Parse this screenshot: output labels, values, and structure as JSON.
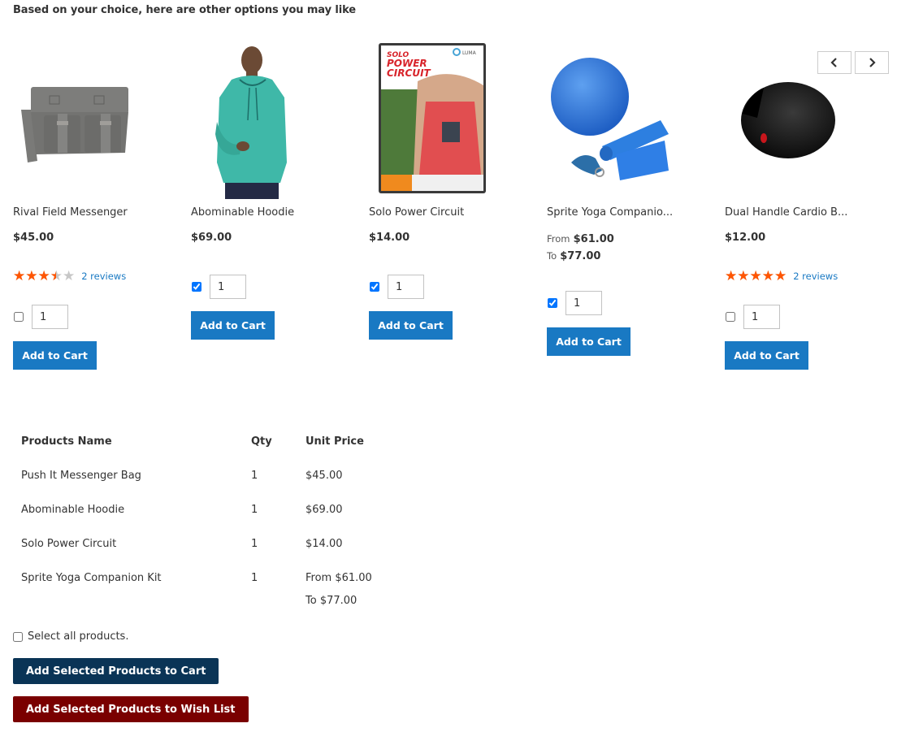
{
  "heading": "Based on your choice, here are other options you may like",
  "carousel": {
    "prev_icon": "chevron-left-icon",
    "next_icon": "chevron-right-icon"
  },
  "colors": {
    "primary_blue": "#1979c3",
    "star_orange": "#ff5501",
    "star_grey": "#c7c7c7",
    "cart_all_bg": "#0a3456",
    "wishlist_bg": "#7a0000"
  },
  "products": [
    {
      "name": "Rival Field Messenger",
      "image": "messenger-bag-image",
      "price": "$45.00",
      "rating_percent": 70,
      "reviews": "2 reviews",
      "checked": false,
      "qty": "1",
      "add_to_cart": "Add to Cart"
    },
    {
      "name": "Abominable Hoodie",
      "image": "hoodie-image",
      "price": "$69.00",
      "checked": true,
      "qty": "1",
      "add_to_cart": "Add to Cart"
    },
    {
      "name": "Solo Power Circuit",
      "image": "dvd-cover-image",
      "price": "$14.00",
      "checked": true,
      "qty": "1",
      "add_to_cart": "Add to Cart"
    },
    {
      "name": "Sprite Yoga Companio...",
      "image": "yoga-kit-image",
      "price_from_label": "From",
      "price_from": "$61.00",
      "price_to_label": "To",
      "price_to": "$77.00",
      "checked": true,
      "qty": "1",
      "add_to_cart": "Add to Cart"
    },
    {
      "name": "Dual Handle Cardio B...",
      "image": "cardio-ball-image",
      "price": "$12.00",
      "rating_percent": 100,
      "reviews": "2 reviews",
      "checked": false,
      "qty": "1",
      "add_to_cart": "Add to Cart"
    }
  ],
  "table": {
    "headers": [
      "Products Name",
      "Qty",
      "Unit Price"
    ],
    "rows": [
      {
        "name": "Push It Messenger Bag",
        "qty": "1",
        "price": "$45.00"
      },
      {
        "name": "Abominable Hoodie",
        "qty": "1",
        "price": "$69.00"
      },
      {
        "name": "Solo Power Circuit",
        "qty": "1",
        "price": "$14.00"
      },
      {
        "name": "Sprite Yoga Companion Kit",
        "qty": "1",
        "price": "From $61.00",
        "price2": "To $77.00"
      }
    ]
  },
  "select_all_label": "Select all products.",
  "add_selected_to_cart": "Add Selected Products to Cart",
  "add_selected_to_wishlist": "Add Selected Products to Wish List"
}
